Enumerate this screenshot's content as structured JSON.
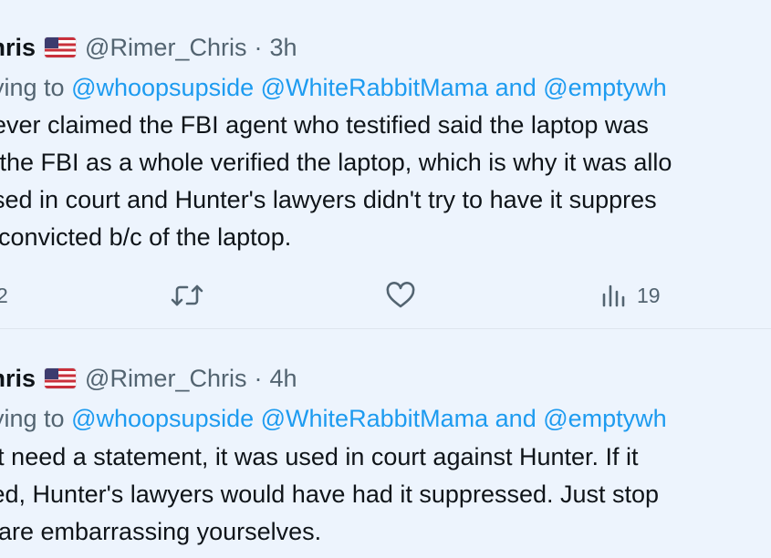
{
  "tweets": [
    {
      "display_name": "Chris",
      "handle": "@Rimer_Chris",
      "separator": "·",
      "time": "3h",
      "replying_to_label": "plying to ",
      "replying_mentions": [
        "@whoopsupside",
        "@WhiteRabbitMama",
        "@emptywh"
      ],
      "and_word": "and",
      "body_lines": [
        " never claimed the FBI agent who testified said the laptop was",
        "d the FBI as a whole verified the laptop, which is why it was allo",
        "used in court and Hunter's lawyers didn't try to have it suppres",
        "s convicted b/c of the laptop."
      ],
      "actions": {
        "reply_count": "2",
        "views_count": "19"
      }
    },
    {
      "display_name": "Chris",
      "handle": "@Rimer_Chris",
      "separator": "·",
      "time": "4h",
      "replying_to_label": "plying to ",
      "replying_mentions": [
        "@whoopsupside",
        "@WhiteRabbitMama",
        "@emptywh"
      ],
      "and_word": "and",
      "body_lines": [
        "n't need a statement,  it was used in court against Hunter. If it",
        "fied, Hunter's lawyers would have had it suppressed. Just stop",
        "s are embarrassing yourselves."
      ]
    }
  ],
  "icons": {
    "flag": "us-flag-icon",
    "reply": "reply-icon",
    "retweet": "retweet-icon",
    "like": "heart-icon",
    "views": "views-icon"
  },
  "colors": {
    "background": "#edf4fd",
    "text": "#0f1419",
    "secondary": "#536471",
    "link": "#1d9bf0"
  }
}
